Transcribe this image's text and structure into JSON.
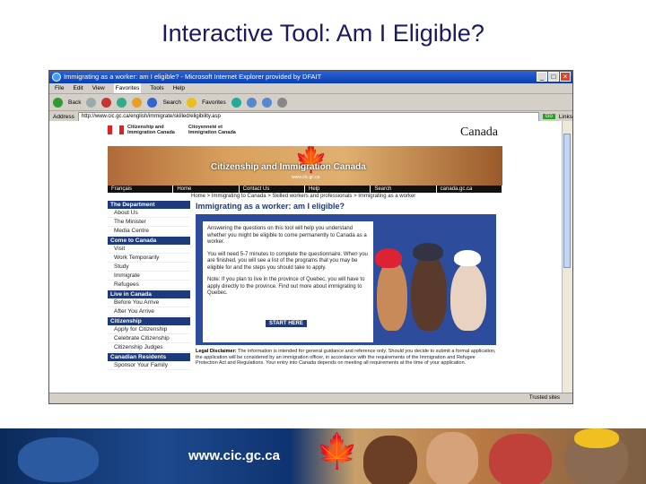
{
  "slide": {
    "title": "Interactive Tool: Am I Eligible?",
    "footer_url": "www.cic.gc.ca"
  },
  "browser": {
    "window_title": "Immigrating as a worker: am I eligible? - Microsoft Internet Explorer provided by DFAIT",
    "menu": [
      "File",
      "Edit",
      "View",
      "Favorites",
      "Tools",
      "Help"
    ],
    "toolbar": {
      "back": "Back",
      "search": "Search",
      "favorites": "Favorites"
    },
    "address_label": "Address",
    "address": "http://www.cic.gc.ca/english/immigrate/skilled/eligibility.asp",
    "go": "Go",
    "links": "Links",
    "status": "Trusted sites"
  },
  "cic": {
    "dept_en": "Citizenship and Immigration Canada",
    "dept_fr": "Citoyenneté et Immigration Canada",
    "wordmark": "Canada",
    "banner_title": "Citizenship and Immigration Canada",
    "banner_url": "www.cic.gc.ca",
    "nav": [
      "Français",
      "Home",
      "Contact Us",
      "Help",
      "Search",
      "canada.gc.ca"
    ],
    "breadcrumb": "Home > Immigrating to Canada > Skilled workers and professionals > Immigrating as a worker",
    "left_nav": [
      {
        "section": "The Department",
        "items": [
          "About Us",
          "The Minister",
          "Media Centre"
        ]
      },
      {
        "section": "Come to Canada",
        "items": [
          "Visit",
          "Work Temporarily",
          "Study",
          "Immigrate",
          "Refugees"
        ]
      },
      {
        "section": "Live in Canada",
        "items": [
          "Before You Arrive",
          "After You Arrive"
        ]
      },
      {
        "section": "Citizenship",
        "items": [
          "Apply for Citizenship",
          "Celebrate Citizenship",
          "Citizenship Judges"
        ]
      },
      {
        "section": "Canadian Residents",
        "items": [
          "Sponsor Your Family"
        ]
      }
    ],
    "page_heading": "Immigrating as a worker: am I eligible?",
    "intro": [
      "Answering the questions on this tool will help you understand whether you might be eligible to come permanently to Canada as a worker.",
      "You will need 5-7 minutes to complete the questionnaire. When you are finished, you will see a list of the programs that you may be eligible for and the steps you should take to apply.",
      "Note: If you plan to live in the province of Quebec, you will have to apply directly to the province. Find out more about immigrating to Quebec."
    ],
    "start_button": "START HERE",
    "disclaimer_label": "Legal Disclaimer:",
    "disclaimer": "The information is intended for general guidance and reference only. Should you decide to submit a formal application, the application will be considered by an immigration officer, in accordance with the requirements of the Immigration and Refugee Protection Act and Regulations. Your entry into Canada depends on meeting all requirements at the time of your application."
  },
  "colors": {
    "accent": "#1e3a7a",
    "title": "#1a1a60",
    "maple": "#d8161b"
  }
}
